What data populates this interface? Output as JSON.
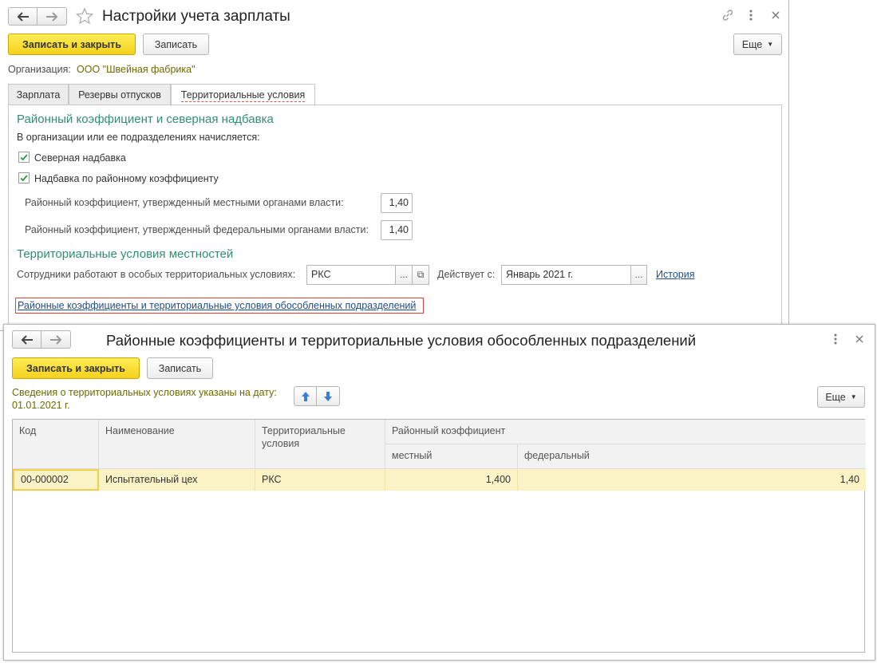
{
  "window1": {
    "title": "Настройки учета зарплаты",
    "save_close_label": "Записать и закрыть",
    "save_label": "Записать",
    "more_label": "Еще",
    "org_label": "Организация:",
    "org_value": "ООО \"Швейная фабрика\"",
    "tabs": [
      {
        "label": "Зарплата"
      },
      {
        "label": "Резервы отпусков"
      },
      {
        "label": "Территориальные условия"
      }
    ],
    "section1_title": "Районный коэффициент и северная надбавка",
    "section1_note": "В организации или ее подразделениях начисляется:",
    "checkbox_north": {
      "label": "Северная надбавка",
      "checked": true
    },
    "checkbox_regional": {
      "label": "Надбавка по районному коэффициенту",
      "checked": true
    },
    "coef_local_label": "Районный коэффициент, утвержденный местными органами власти:",
    "coef_local_value": "1,40",
    "coef_federal_label": "Районный коэффициент, утвержденный федеральными органами власти:",
    "coef_federal_value": "1,40",
    "section2_title": "Территориальные условия местностей",
    "terr_label": "Сотрудники работают в особых территориальных условиях:",
    "terr_value": "РКС",
    "valid_from_label": "Действует с:",
    "valid_from_value": "Январь 2021 г.",
    "history_link": "История",
    "subdivisions_link": "Районные коэффициенты и территориальные условия обособленных подразделений",
    "dots": "...",
    "open_glyph": "⧉"
  },
  "window2": {
    "title": "Районные коэффициенты и территориальные условия обособленных подразделений",
    "save_close_label": "Записать и закрыть",
    "save_label": "Записать",
    "more_label": "Еще",
    "date_note": "Сведения о территориальных условиях указаны на дату:",
    "date_value": "01.01.2021 г.",
    "table": {
      "headers": {
        "code": "Код",
        "name": "Наименование",
        "terr": "Территориальные условия",
        "coef": "Районный коэффициент",
        "local": "местный",
        "federal": "федеральный"
      },
      "rows": [
        {
          "code": "00-000002",
          "name": "Испытательный цех",
          "terr": "РКС",
          "local": "1,400",
          "federal": "1,40"
        }
      ]
    }
  },
  "colors": {
    "accent_yellow": "#f5d11e",
    "section_green": "#2f8f6f",
    "link_blue": "#1f4d8a",
    "selected_row": "#fbf3c6"
  },
  "icons": {
    "back": "arrow-left-icon",
    "forward": "arrow-right-icon",
    "star": "star-icon",
    "link": "link-icon",
    "menu": "more-vertical-icon",
    "close": "close-icon",
    "up": "arrow-up-icon",
    "down": "arrow-down-icon"
  }
}
